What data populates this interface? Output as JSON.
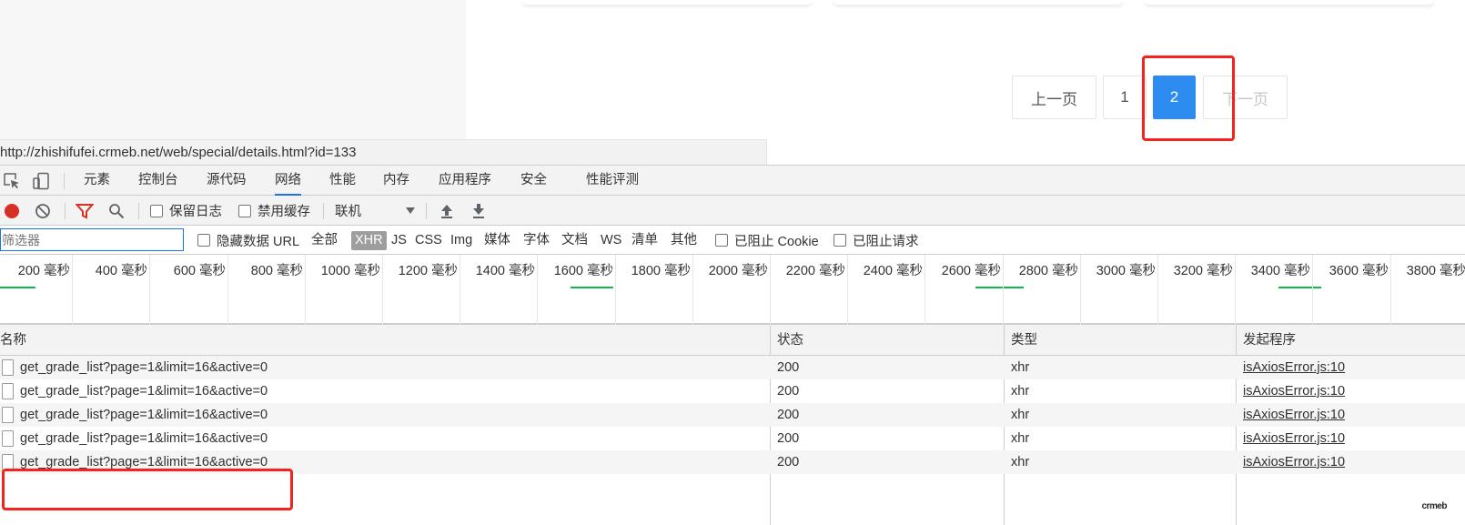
{
  "pagination": {
    "prev_label": "上一页",
    "pages": [
      "1",
      "2"
    ],
    "active_page": "2",
    "next_label": "下一页"
  },
  "url_tooltip": "http://zhishifufei.crmeb.net/web/special/details.html?id=133",
  "devtools": {
    "tabs": [
      "元素",
      "控制台",
      "源代码",
      "网络",
      "性能",
      "内存",
      "应用程序",
      "安全",
      "性能评测"
    ],
    "active_tab": "网络",
    "toolbar": {
      "preserve_log": "保留日志",
      "disable_cache": "禁用缓存",
      "throttle": "联机"
    },
    "filter": {
      "placeholder": "筛选器",
      "hide_data_url": "隐藏数据 URL",
      "types": [
        "全部",
        "XHR",
        "JS",
        "CSS",
        "Img",
        "媒体",
        "字体",
        "文档",
        "WS",
        "清单",
        "其他"
      ],
      "active_type": "XHR",
      "blocked_cookies": "已阻止 Cookie",
      "blocked_requests": "已阻止请求"
    },
    "timeline_ticks": [
      "200 毫秒",
      "400 毫秒",
      "600 毫秒",
      "800 毫秒",
      "1000 毫秒",
      "1200 毫秒",
      "1400 毫秒",
      "1600 毫秒",
      "1800 毫秒",
      "2000 毫秒",
      "2200 毫秒",
      "2400 毫秒",
      "2600 毫秒",
      "2800 毫秒",
      "3000 毫秒",
      "3200 毫秒",
      "3400 毫秒",
      "3600 毫秒",
      "3800 毫秒"
    ],
    "columns": [
      "名称",
      "状态",
      "类型",
      "发起程序"
    ],
    "requests": [
      {
        "name": "get_grade_list?page=1&limit=16&active=0",
        "status": "200",
        "type": "xhr",
        "initiator": "isAxiosError.js:10"
      },
      {
        "name": "get_grade_list?page=1&limit=16&active=0",
        "status": "200",
        "type": "xhr",
        "initiator": "isAxiosError.js:10"
      },
      {
        "name": "get_grade_list?page=1&limit=16&active=0",
        "status": "200",
        "type": "xhr",
        "initiator": "isAxiosError.js:10"
      },
      {
        "name": "get_grade_list?page=1&limit=16&active=0",
        "status": "200",
        "type": "xhr",
        "initiator": "isAxiosError.js:10"
      },
      {
        "name": "get_grade_list?page=1&limit=16&active=0",
        "status": "200",
        "type": "xhr",
        "initiator": "isAxiosError.js:10"
      }
    ]
  },
  "watermark": "crmeb",
  "colors": {
    "active_page": "#2d8cf0",
    "highlight_box": "#f4231f",
    "timeline_bar": "#0fb94b",
    "record_button": "#d93025",
    "devtools_accent": "#1a73e8"
  }
}
